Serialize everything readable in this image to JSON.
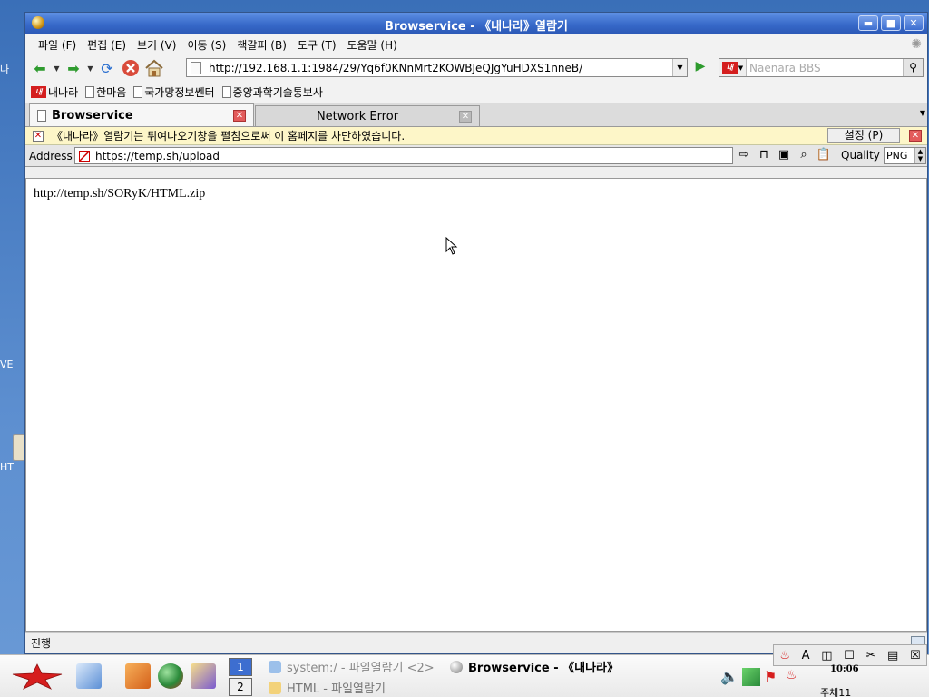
{
  "desktop": {
    "icon_labels": [
      "나",
      "VE",
      "HT"
    ]
  },
  "window": {
    "title": "Browservice - 《내나라》열람기",
    "buttons": {
      "minimize": "▬",
      "maximize": "■",
      "close": "✕"
    }
  },
  "menu": {
    "items": [
      "파일 (F)",
      "편집 (E)",
      "보기 (V)",
      "이동 (S)",
      "책갈피 (B)",
      "도구 (T)",
      "도움말 (H)"
    ]
  },
  "nav": {
    "url": "http://192.168.1.1:1984/29/Yq6f0KNnMrt2KOWBJeQJgYuHDXS1nneB/",
    "search_placeholder": "Naenara BBS",
    "engine_logo": "내"
  },
  "bookmarks": {
    "items": [
      "내나라",
      "한마음",
      "국가망정보쎈터",
      "중앙과학기술통보사"
    ]
  },
  "tabs": [
    {
      "label": "Browservice",
      "active": true
    },
    {
      "label": "Network Error",
      "active": false
    }
  ],
  "notification": {
    "message": "《내나라》열람기는 튀여나오기창을 펼침으로써 이 홈페지를 차단하였습니다.",
    "options_label": "설정 (P)"
  },
  "browservice_bar": {
    "address_label": "Address",
    "address_value": "https://temp.sh/upload",
    "quality_label": "Quality",
    "quality_value": "PNG"
  },
  "page": {
    "text": "http://temp.sh/SORyK/HTML.zip"
  },
  "status": {
    "text": "진행"
  },
  "taskbar": {
    "workspaces": [
      "1",
      "2"
    ],
    "tasks": [
      "system:/ - 파일열람기 <2>",
      "Browservice - 《내나라》",
      "HTML - 파일열람기"
    ],
    "clock": "10:06",
    "date": "주체11"
  },
  "colors": {
    "titlebar": "#3769c9",
    "desktop": "#4a7dc4",
    "notification": "#fdf6c8",
    "brand_red": "#d41e1e"
  }
}
